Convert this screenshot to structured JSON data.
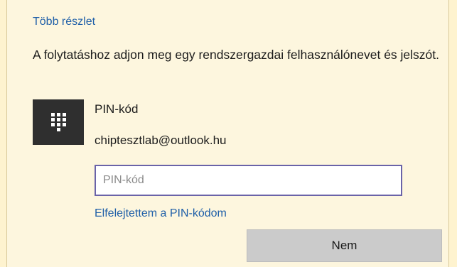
{
  "links": {
    "more_details": "Több részlet",
    "forgot_pin": "Elfelejtettem a PIN-kódom"
  },
  "prompt": {
    "message": "A folytatáshoz adjon meg egy rendszergazdai felhasználónevet és jelszót."
  },
  "credential": {
    "icon": "keypad-icon",
    "title": "PIN-kód",
    "account": "chiptesztlab@outlook.hu"
  },
  "pin_field": {
    "value": "",
    "placeholder": "PIN-kód"
  },
  "buttons": {
    "no_label": "Nem"
  },
  "colors": {
    "page_background": "#fef3cf",
    "link": "#1f5fa8",
    "input_border": "#6a63a8",
    "button_background": "#cbcbcb",
    "tile_background": "#2f2f2f"
  }
}
